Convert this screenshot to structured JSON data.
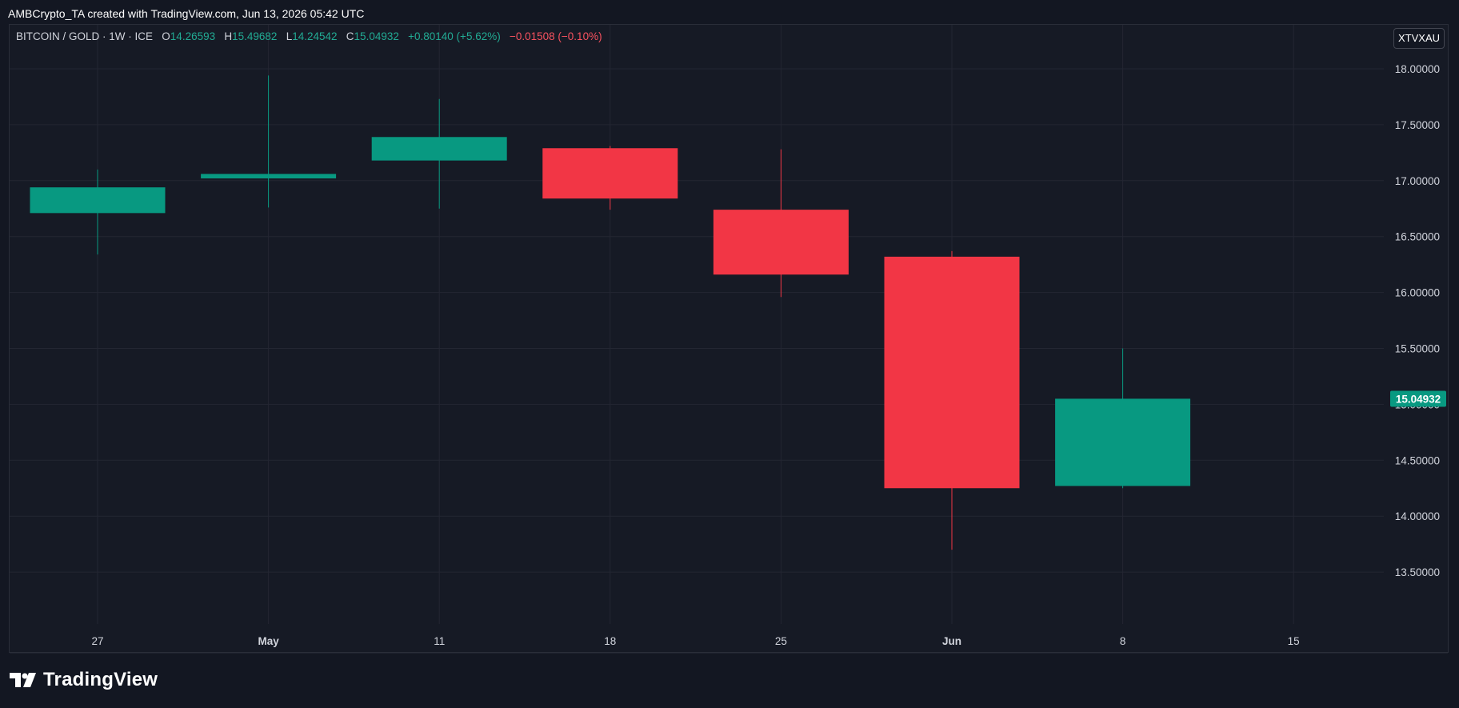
{
  "header": {
    "title": "AMBCrypto_TA created with TradingView.com, Jun 13, 2026 05:42 UTC"
  },
  "legend": {
    "symbol": "BITCOIN / GOLD · 1W · ICE",
    "o_label": "O",
    "o_value": "14.26593",
    "h_label": "H",
    "h_value": "15.49682",
    "l_label": "L",
    "l_value": "14.24542",
    "c_label": "C",
    "c_value": "15.04932",
    "change": "+0.80140 (+5.62%)",
    "extra": "−0.01508 (−0.10%)"
  },
  "symbol_badge": "XTVXAU",
  "footer": {
    "brand": "TradingView"
  },
  "colors": {
    "up": "#089981",
    "down": "#f23645",
    "background": "#161a25",
    "grid": "#232632",
    "axis_text": "#d1d4dc"
  },
  "chart_data": {
    "type": "candlestick",
    "x_ticks": [
      {
        "label": "27",
        "bold": false
      },
      {
        "label": "May",
        "bold": true
      },
      {
        "label": "11",
        "bold": false
      },
      {
        "label": "18",
        "bold": false
      },
      {
        "label": "25",
        "bold": false
      },
      {
        "label": "Jun",
        "bold": true
      },
      {
        "label": "8",
        "bold": false
      },
      {
        "label": "15",
        "bold": false
      }
    ],
    "y_ticks": [
      "13.50000",
      "14.00000",
      "14.50000",
      "15.00000",
      "15.50000",
      "16.00000",
      "16.50000",
      "17.00000",
      "17.50000",
      "18.00000"
    ],
    "ylim": [
      13.5,
      18.0
    ],
    "last_price_label": "15.04932",
    "last_price": 15.04932,
    "candles": [
      {
        "x": 0,
        "open": 16.71,
        "high": 17.1,
        "low": 16.34,
        "close": 16.94
      },
      {
        "x": 1,
        "open": 17.02,
        "high": 17.94,
        "low": 16.76,
        "close": 17.06
      },
      {
        "x": 2,
        "open": 17.18,
        "high": 17.73,
        "low": 16.75,
        "close": 17.39
      },
      {
        "x": 3,
        "open": 17.29,
        "high": 17.31,
        "low": 16.74,
        "close": 16.84
      },
      {
        "x": 4,
        "open": 16.74,
        "high": 17.28,
        "low": 15.96,
        "close": 16.16
      },
      {
        "x": 5,
        "open": 16.32,
        "high": 16.37,
        "low": 13.7,
        "close": 14.25
      },
      {
        "x": 6,
        "open": 14.27,
        "high": 15.5,
        "low": 14.25,
        "close": 15.05
      }
    ]
  }
}
